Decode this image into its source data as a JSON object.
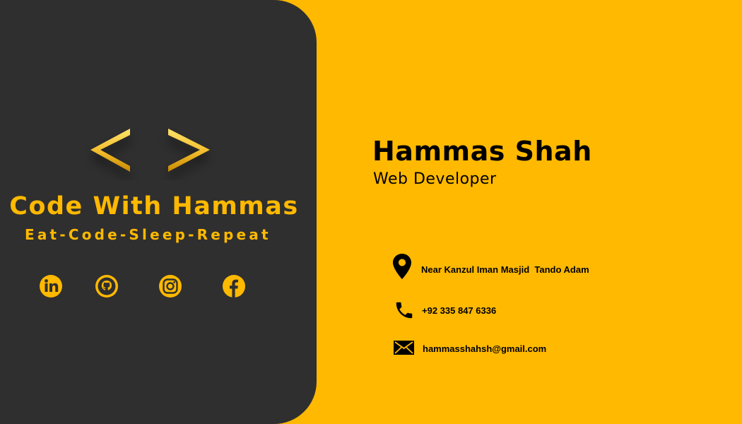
{
  "brand": {
    "name": "Code With Hammas",
    "tagline": "Eat-Code-Sleep-Repeat",
    "accent_color": "#ffb900",
    "panel_color": "#2f2f2f",
    "logo_icon": "code-brackets-icon"
  },
  "social": [
    {
      "name": "linkedin",
      "icon": "linkedin-icon"
    },
    {
      "name": "github",
      "icon": "github-icon"
    },
    {
      "name": "instagram",
      "icon": "instagram-icon"
    },
    {
      "name": "facebook",
      "icon": "facebook-icon"
    }
  ],
  "person": {
    "name": "Hammas Shah",
    "role": "Web Developer"
  },
  "contact": {
    "address": "Near Kanzul Iman Masjid  Tando Adam",
    "phone": "+92 335 847 6336",
    "email": "hammasshahsh@gmail.com",
    "address_icon": "map-pin-icon",
    "phone_icon": "phone-icon",
    "email_icon": "mail-icon"
  }
}
